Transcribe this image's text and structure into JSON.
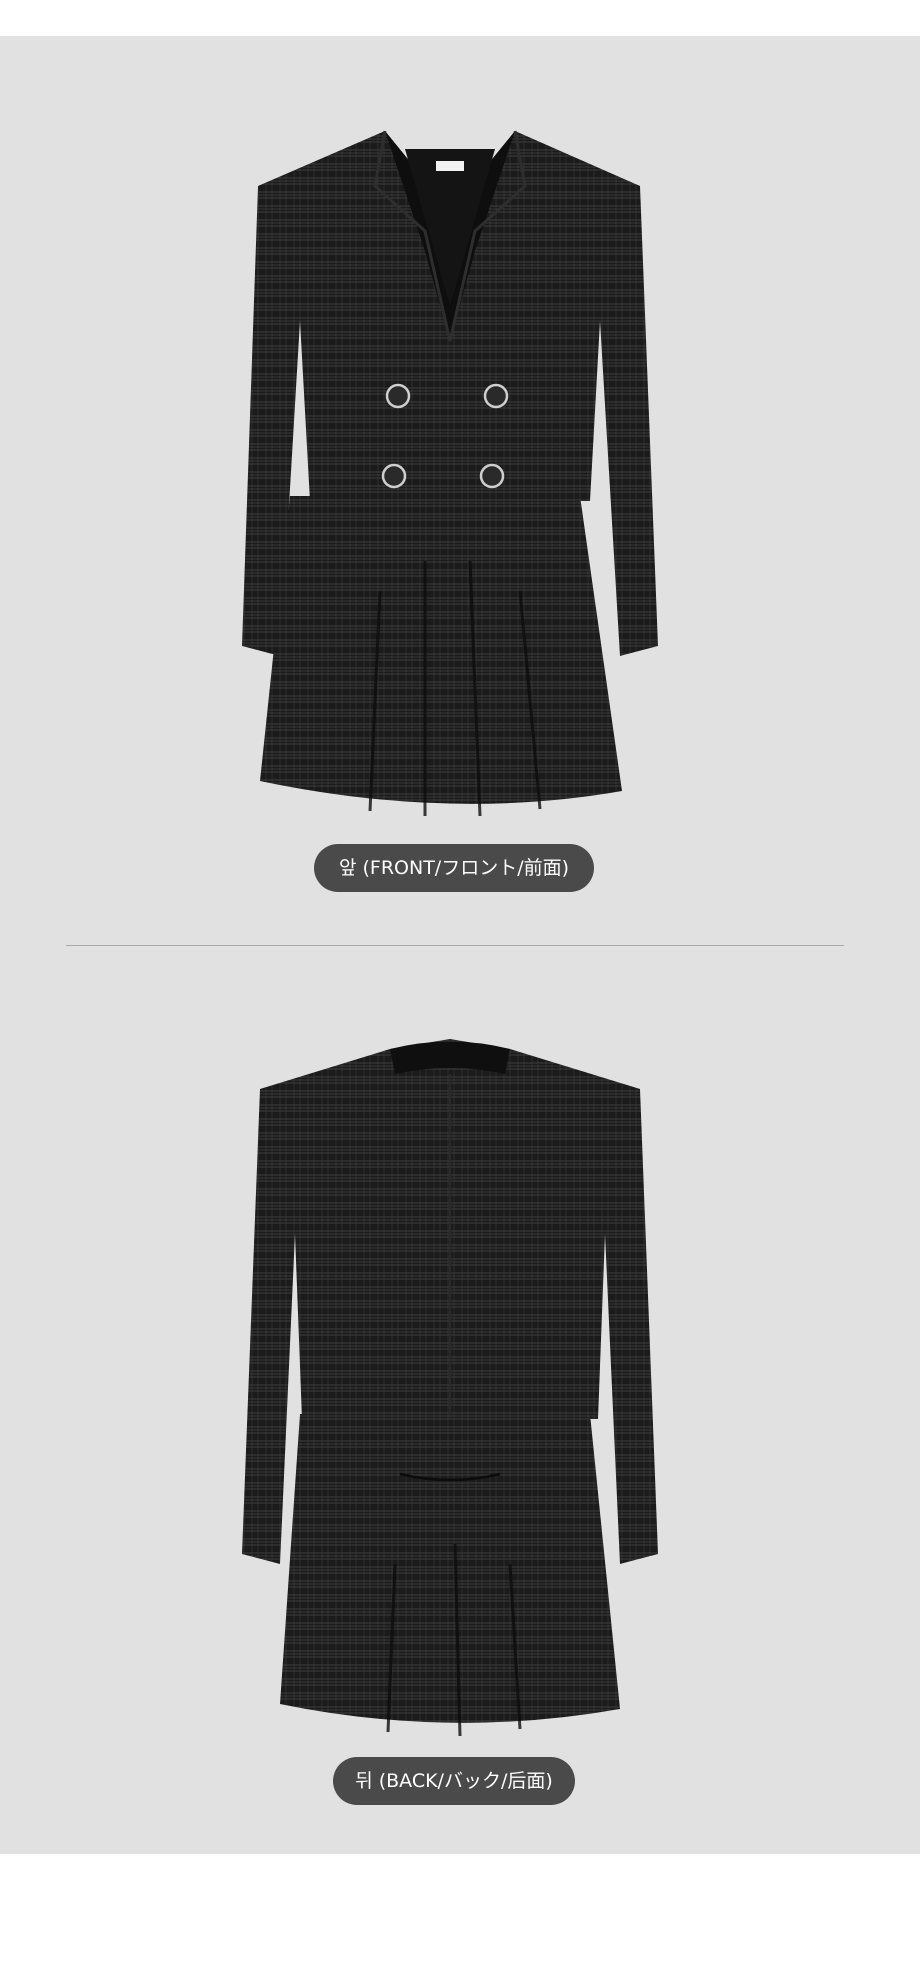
{
  "labels": {
    "front": "앞 (FRONT/フロント/前面)",
    "back": "뒤 (BACK/バック/后面)"
  },
  "colors": {
    "background": "#e1e1e1",
    "pill": "#4a4a4a",
    "pill_text": "#ffffff",
    "fabric": "#1b1b1b"
  }
}
